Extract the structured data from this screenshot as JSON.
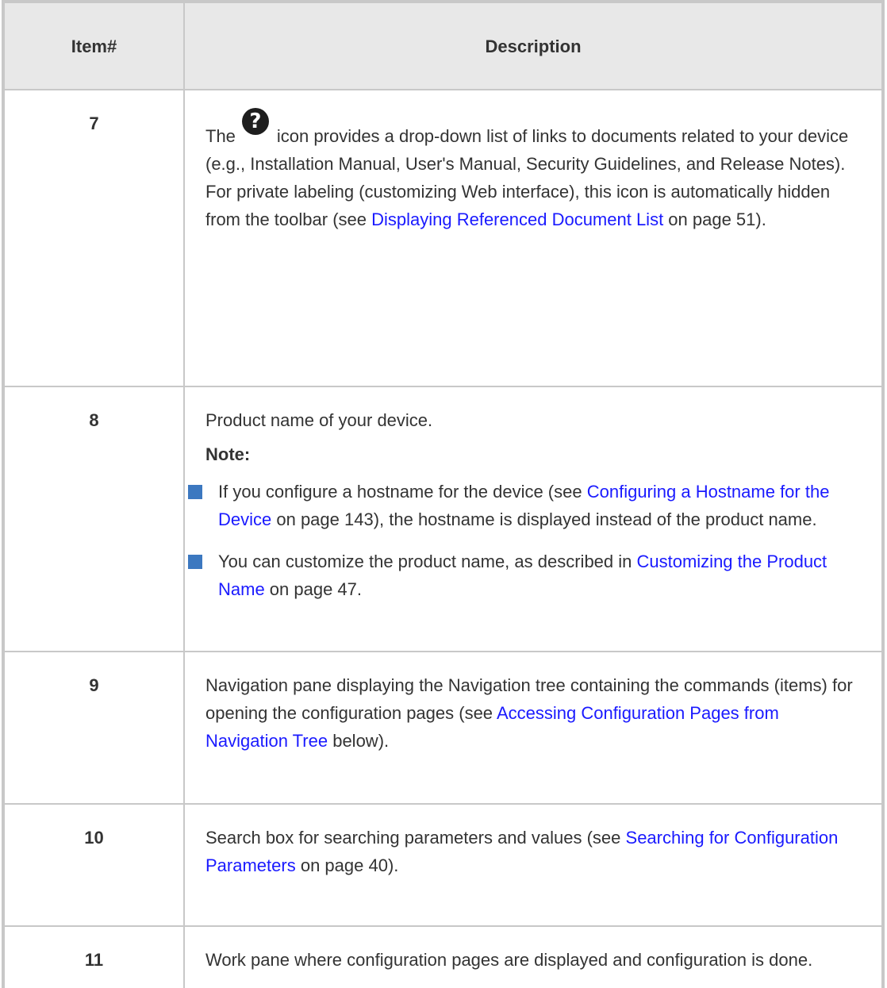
{
  "table": {
    "header": {
      "item": "Item#",
      "description": "Description"
    },
    "rows": {
      "r7": {
        "item": "7",
        "icon": "help-question-icon",
        "icon_glyph": "?",
        "text_before_icon": "The",
        "text_1": "icon provides a drop-down list of links to documents related to your device (e.g., Installation Manual, User's Manual, Security Guidelines, and Release Notes). For private labeling (customizing Web interface), this icon is automatically hidden from the toolbar (see ",
        "link": "Displaying Referenced Document List",
        "text_2": " on page 51)."
      },
      "r8": {
        "item": "8",
        "text": "Product name of your device.",
        "note_label": "Note:",
        "bullet_1": {
          "text_1": "If you configure a hostname for the device (see ",
          "link": "Configuring a Hostname for the Device",
          "text_2": " on page 143), the hostname is displayed instead of the product name."
        },
        "bullet_2": {
          "text_1": "You can customize the product name, as described in ",
          "link": "Customizing the Product Name",
          "text_2": " on page 47."
        }
      },
      "r9": {
        "item": "9",
        "text_1": "Navigation pane displaying the Navigation tree containing the commands (items) for opening the configuration pages (see ",
        "link": "Accessing Configuration Pages from Navigation Tree",
        "text_2": " below)."
      },
      "r10": {
        "item": "10",
        "text_1": "Search box for searching parameters and values (see ",
        "link": "Searching for Configuration Parameters",
        "text_2": " on page 40)."
      },
      "r11": {
        "item": "11",
        "text": "Work pane where configuration pages are displayed and configuration is done."
      }
    }
  },
  "colors": {
    "link": "#1a1aff",
    "bullet": "#3c78c0",
    "header_bg": "#e8e8e8",
    "border": "#c8c8c8"
  }
}
